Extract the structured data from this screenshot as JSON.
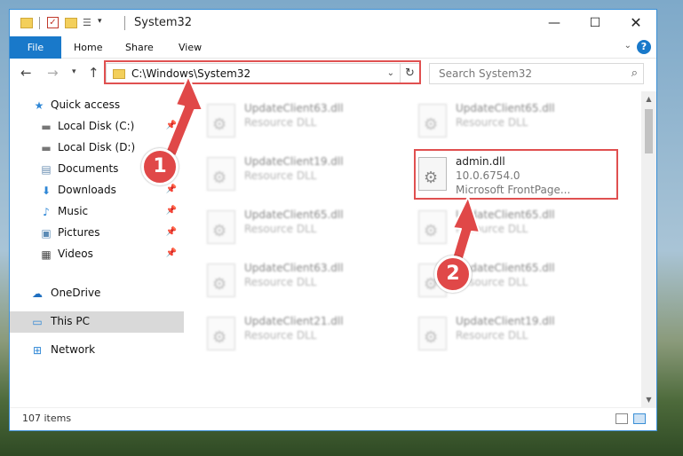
{
  "window": {
    "title": "System32",
    "min": "—",
    "max": "☐",
    "close": "✕"
  },
  "ribbon": {
    "tabs": [
      {
        "label": "File"
      },
      {
        "label": "Home"
      },
      {
        "label": "Share"
      },
      {
        "label": "View"
      }
    ],
    "help": "?"
  },
  "address": {
    "path": "C:\\Windows\\System32",
    "search_placeholder": "Search System32"
  },
  "sidebar": {
    "items": [
      {
        "label": "Quick access",
        "icon": "star-icon"
      },
      {
        "label": "Local Disk (C:)",
        "icon": "drive-icon",
        "pinned": true
      },
      {
        "label": "Local Disk (D:)",
        "icon": "drive-icon",
        "pinned": true
      },
      {
        "label": "Documents",
        "icon": "documents-icon",
        "pinned": true
      },
      {
        "label": "Downloads",
        "icon": "downloads-icon",
        "pinned": true
      },
      {
        "label": "Music",
        "icon": "music-icon",
        "pinned": true
      },
      {
        "label": "Pictures",
        "icon": "pictures-icon",
        "pinned": true
      },
      {
        "label": "Videos",
        "icon": "videos-icon",
        "pinned": true
      },
      {
        "label": "OneDrive",
        "icon": "cloud-icon"
      },
      {
        "label": "This PC",
        "icon": "computer-icon",
        "selected": true
      },
      {
        "label": "Network",
        "icon": "network-icon"
      }
    ]
  },
  "files": [
    {
      "name": "UpdateClient63.dll",
      "line2": "Resource DLL",
      "line3": ""
    },
    {
      "name": "UpdateClient65.dll",
      "line2": "Resource DLL",
      "line3": ""
    },
    {
      "name": "UpdateClient19.dll",
      "line2": "Resource DLL",
      "line3": ""
    },
    {
      "name": "admin.dll",
      "line2": "10.0.6754.0",
      "line3": "Microsoft FrontPage..."
    },
    {
      "name": "UpdateClient65.dll",
      "line2": "Resource DLL",
      "line3": ""
    },
    {
      "name": "UpdateClient65.dll",
      "line2": "Resource DLL",
      "line3": ""
    },
    {
      "name": "UpdateClient63.dll",
      "line2": "Resource DLL",
      "line3": ""
    },
    {
      "name": "UpdateClient65.dll",
      "line2": "Resource DLL",
      "line3": ""
    },
    {
      "name": "UpdateClient21.dll",
      "line2": "Resource DLL",
      "line3": ""
    },
    {
      "name": "UpdateClient19.dll",
      "line2": "Resource DLL",
      "line3": ""
    }
  ],
  "status": {
    "item_count": "107 items"
  },
  "annotations": {
    "step1": "1",
    "step2": "2",
    "color": "#e04848"
  }
}
